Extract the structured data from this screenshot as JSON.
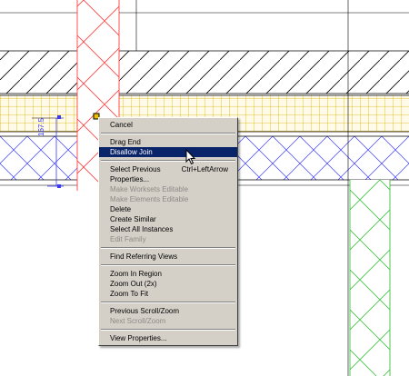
{
  "drawing": {
    "dimension_text": "167.5"
  },
  "context_menu": {
    "groups": [
      [
        {
          "label": "Cancel",
          "enabled": true
        }
      ],
      [
        {
          "label": "Drag End",
          "enabled": true
        },
        {
          "label": "Disallow Join",
          "enabled": true,
          "highlighted": true
        }
      ],
      [
        {
          "label": "Select Previous",
          "shortcut": "Ctrl+LeftArrow",
          "enabled": true
        },
        {
          "label": "Properties...",
          "enabled": true
        },
        {
          "label": "Make Worksets Editable",
          "enabled": false
        },
        {
          "label": "Make Elements Editable",
          "enabled": false
        },
        {
          "label": "Delete",
          "enabled": true
        },
        {
          "label": "Create Similar",
          "enabled": true
        },
        {
          "label": "Select All Instances",
          "enabled": true
        },
        {
          "label": "Edit Family",
          "enabled": false
        }
      ],
      [
        {
          "label": "Find Referring Views",
          "enabled": true
        }
      ],
      [
        {
          "label": "Zoom In Region",
          "enabled": true
        },
        {
          "label": "Zoom Out (2x)",
          "enabled": true
        },
        {
          "label": "Zoom To Fit",
          "enabled": true
        }
      ],
      [
        {
          "label": "Previous Scroll/Zoom",
          "enabled": true
        },
        {
          "label": "Next Scroll/Zoom",
          "enabled": false
        }
      ],
      [
        {
          "label": "View Properties...",
          "enabled": true
        }
      ]
    ]
  },
  "colors": {
    "highlight": "#0a246a",
    "menu_bg": "#d4d0c8",
    "disabled_text": "#8d8b86",
    "column_red": "#ff4040",
    "insulation_yellow": "#e8c000",
    "hatch_blue": "#3a3aff",
    "column_green": "#40c040"
  }
}
